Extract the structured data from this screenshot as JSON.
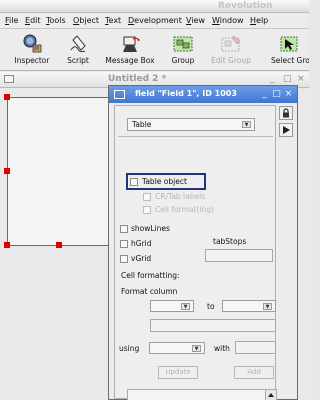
{
  "app": {
    "title": "Revolution"
  },
  "menu": [
    {
      "acc": "F",
      "rest": "ile"
    },
    {
      "acc": "E",
      "rest": "dit"
    },
    {
      "acc": "T",
      "rest": "ools"
    },
    {
      "acc": "O",
      "rest": "bject"
    },
    {
      "acc": "T",
      "rest": "ext"
    },
    {
      "acc": "D",
      "rest": "evelopment"
    },
    {
      "acc": "V",
      "rest": "iew"
    },
    {
      "acc": "W",
      "rest": "indow"
    },
    {
      "acc": "H",
      "rest": "elp"
    }
  ],
  "toolbar": {
    "inspector": "Inspector",
    "script": "Script",
    "message_box": "Message Box",
    "group": "Group",
    "edit_group": "Edit Group",
    "select_grouped": "Select Gro"
  },
  "stack": {
    "title": "Untitled 2 *",
    "controls": [
      "_",
      "□",
      "×"
    ]
  },
  "inspector": {
    "title": "field \"Field 1\", ID 1003",
    "title_controls": [
      "_",
      "□",
      "×"
    ],
    "section": "Table",
    "table_object": "Table object",
    "cr_tab_labels": "CR/Tab labels",
    "cell_format": "Cell format(ing)",
    "show_lines": "showLines",
    "hgrid": "hGrid",
    "vgrid": "vGrid",
    "tabstops": "tabStops",
    "cell_formatting": "Cell formatting:",
    "format_column": "Format column",
    "to": "to",
    "using": "using",
    "with": "with",
    "update": "Update",
    "add": "Add"
  },
  "colors": {
    "titlebar": "#4074d2",
    "handle": "#e00000",
    "focus": "#23327f"
  }
}
